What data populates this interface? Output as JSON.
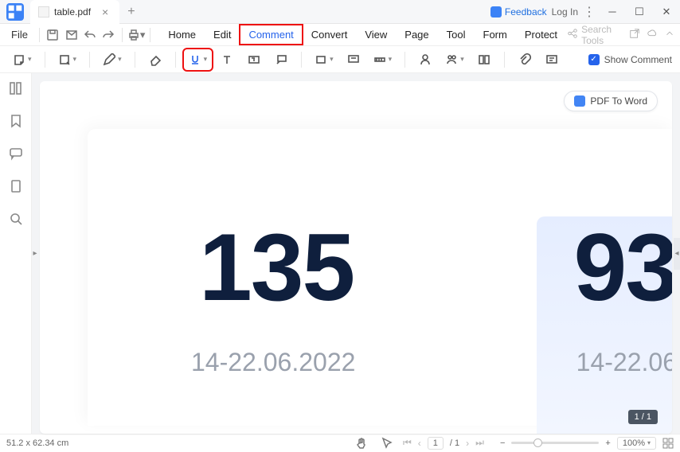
{
  "titlebar": {
    "tab_name": "table.pdf",
    "feedback": "Feedback",
    "login": "Log In"
  },
  "menu": {
    "file": "File",
    "nav": [
      "Home",
      "Edit",
      "Comment",
      "Convert",
      "View",
      "Page",
      "Tool",
      "Form",
      "Protect"
    ],
    "search_placeholder": "Search Tools"
  },
  "toolbar": {
    "show_comment": "Show Comment"
  },
  "doc": {
    "pdf_to_word": "PDF To Word",
    "big1": "135",
    "date1": "14-22.06.2022",
    "big2": "93",
    "date2": "14-22.06",
    "page_indicator": "1 / 1"
  },
  "status": {
    "dimensions": "51.2 x 62.34 cm",
    "page_current": "1",
    "page_total": "/ 1",
    "zoom": "100%"
  }
}
